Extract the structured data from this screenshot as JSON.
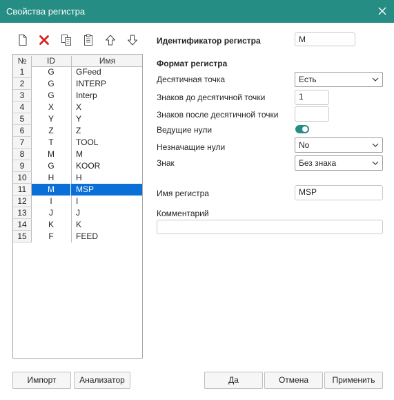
{
  "window": {
    "title": "Свойства регистра"
  },
  "toolbar": [
    {
      "icon": "new-document-icon"
    },
    {
      "icon": "delete-icon",
      "color": "#d81f1f"
    },
    {
      "icon": "copy-icon"
    },
    {
      "icon": "paste-icon"
    },
    {
      "icon": "move-up-icon"
    },
    {
      "icon": "move-down-icon"
    }
  ],
  "table": {
    "headers": {
      "num": "№",
      "id": "ID",
      "name": "Имя"
    },
    "rows": [
      {
        "num": "1",
        "id": "G",
        "name": "GFeed"
      },
      {
        "num": "2",
        "id": "G",
        "name": "INTERP"
      },
      {
        "num": "3",
        "id": "G",
        "name": "Interp"
      },
      {
        "num": "4",
        "id": "X",
        "name": "X"
      },
      {
        "num": "5",
        "id": "Y",
        "name": "Y"
      },
      {
        "num": "6",
        "id": "Z",
        "name": "Z"
      },
      {
        "num": "7",
        "id": "T",
        "name": "TOOL"
      },
      {
        "num": "8",
        "id": "M",
        "name": "M"
      },
      {
        "num": "9",
        "id": "G",
        "name": "KOOR"
      },
      {
        "num": "10",
        "id": "H",
        "name": "H"
      },
      {
        "num": "11",
        "id": "M",
        "name": "MSP"
      },
      {
        "num": "12",
        "id": "I",
        "name": "I"
      },
      {
        "num": "13",
        "id": "J",
        "name": "J"
      },
      {
        "num": "14",
        "id": "K",
        "name": "K"
      },
      {
        "num": "15",
        "id": "F",
        "name": "FEED"
      }
    ],
    "selected_index": 10,
    "selection_color": "#0a6fd6"
  },
  "props": {
    "identifier_label": "Идентификатор регистра",
    "identifier_value": "M",
    "format_heading": "Формат регистра",
    "decimal_point_label": "Десятичная точка",
    "decimal_point_value": "Есть",
    "digits_before_label": "Знаков до десятичной точки",
    "digits_before_value": "1",
    "digits_after_label": "Знаков после десятичной точки",
    "digits_after_value": "",
    "leading_zeros_label": "Ведущие нули",
    "leading_zeros_on": true,
    "trailing_zeros_label": "Незначащие нули",
    "trailing_zeros_value": "No",
    "sign_label": "Знак",
    "sign_value": "Без знака",
    "name_label": "Имя регистра",
    "name_value": "MSP",
    "comment_label": "Комментарий",
    "comment_value": ""
  },
  "buttons": {
    "import": "Импорт",
    "analyzer": "Анализатор",
    "ok": "Да",
    "cancel": "Отмена",
    "apply": "Применить"
  },
  "colors": {
    "accent": "#268d84",
    "selection": "#0a6fd6"
  }
}
